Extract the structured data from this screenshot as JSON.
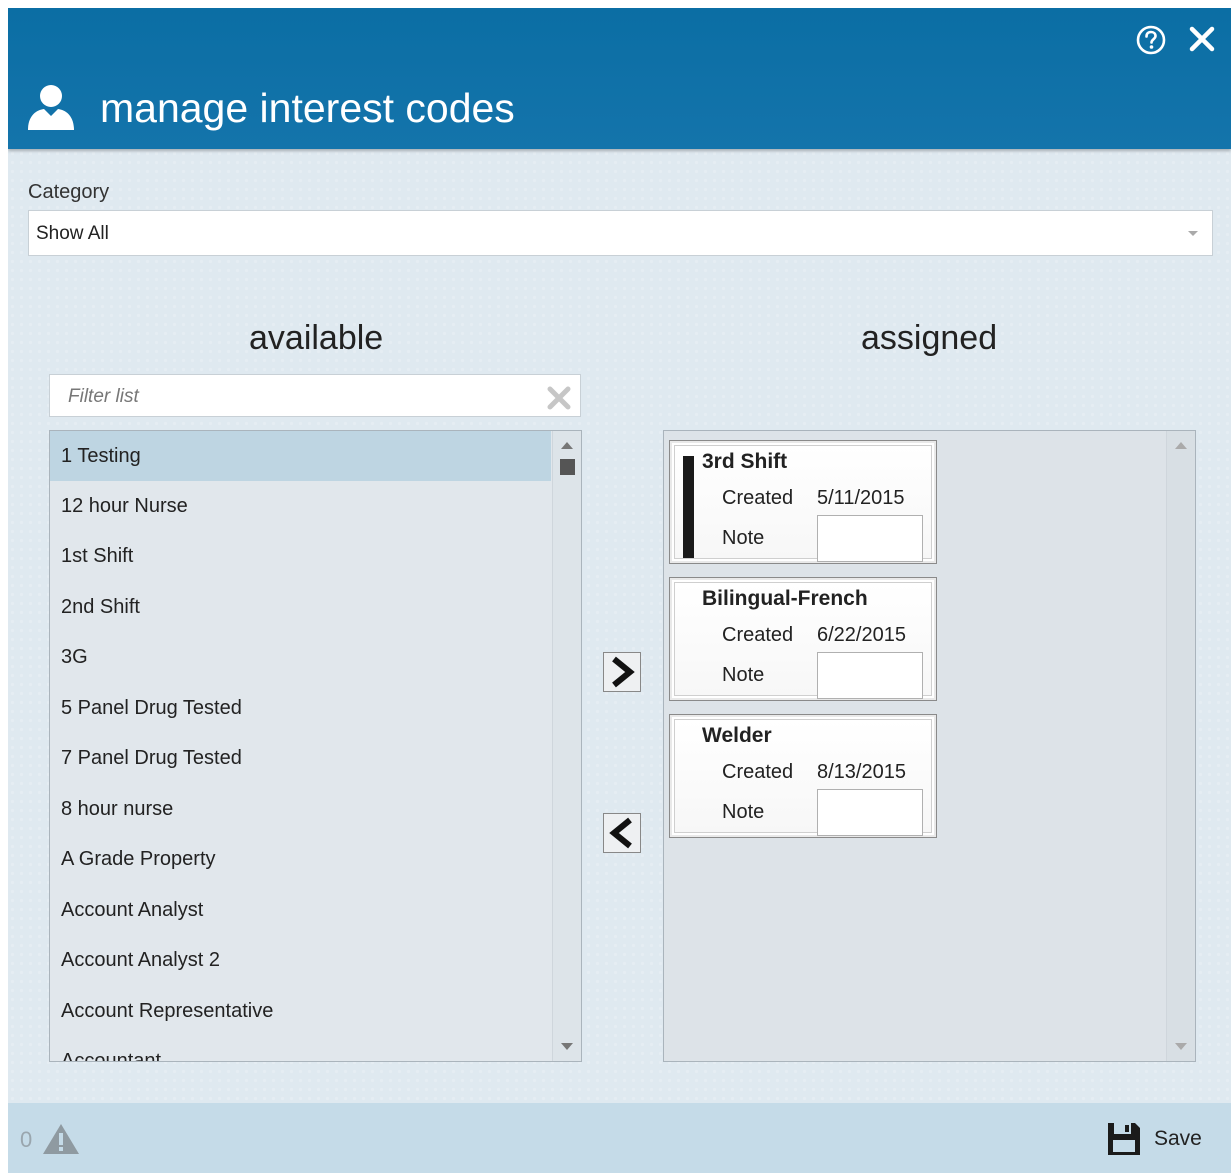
{
  "header": {
    "title": "manage interest codes",
    "icon": "user-icon",
    "help_icon": "help-icon",
    "close_icon": "close-icon"
  },
  "category": {
    "label": "Category",
    "selected": "Show All"
  },
  "available": {
    "title": "available",
    "filter_placeholder": "Filter list",
    "items": [
      "1 Testing",
      "12 hour Nurse",
      "1st Shift",
      "2nd Shift",
      "3G",
      "5 Panel Drug Tested",
      "7 Panel Drug Tested",
      "8 hour nurse",
      "A Grade Property",
      "Account Analyst",
      "Account Analyst 2",
      "Account Representative",
      "Accountant"
    ],
    "selected_index": 0
  },
  "assigned": {
    "title": "assigned",
    "cards": [
      {
        "name": "3rd Shift",
        "created_label": "Created",
        "created": "5/11/2015",
        "note_label": "Note"
      },
      {
        "name": "Bilingual-French",
        "created_label": "Created",
        "created": "6/22/2015",
        "note_label": "Note"
      },
      {
        "name": "Welder",
        "created_label": "Created",
        "created": "8/13/2015",
        "note_label": "Note"
      }
    ]
  },
  "footer": {
    "count": "0",
    "warning_icon": "warning-icon",
    "save_label": "Save",
    "save_icon": "save-icon"
  },
  "colors": {
    "header_bg": "#0b6ea4",
    "body_bg": "#dfe9f0",
    "selected_item": "#bed5e2",
    "footer_bg": "#c5dbe8"
  }
}
